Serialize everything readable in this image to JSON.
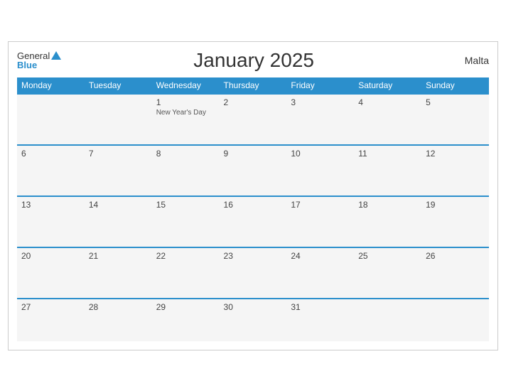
{
  "header": {
    "logo_general": "General",
    "logo_blue": "Blue",
    "title": "January 2025",
    "country": "Malta"
  },
  "weekdays": [
    "Monday",
    "Tuesday",
    "Wednesday",
    "Thursday",
    "Friday",
    "Saturday",
    "Sunday"
  ],
  "weeks": [
    [
      {
        "day": "",
        "empty": true
      },
      {
        "day": "",
        "empty": true
      },
      {
        "day": "1",
        "event": "New Year's Day"
      },
      {
        "day": "2"
      },
      {
        "day": "3"
      },
      {
        "day": "4"
      },
      {
        "day": "5"
      }
    ],
    [
      {
        "day": "6"
      },
      {
        "day": "7"
      },
      {
        "day": "8"
      },
      {
        "day": "9"
      },
      {
        "day": "10"
      },
      {
        "day": "11"
      },
      {
        "day": "12"
      }
    ],
    [
      {
        "day": "13"
      },
      {
        "day": "14"
      },
      {
        "day": "15"
      },
      {
        "day": "16"
      },
      {
        "day": "17"
      },
      {
        "day": "18"
      },
      {
        "day": "19"
      }
    ],
    [
      {
        "day": "20"
      },
      {
        "day": "21"
      },
      {
        "day": "22"
      },
      {
        "day": "23"
      },
      {
        "day": "24"
      },
      {
        "day": "25"
      },
      {
        "day": "26"
      }
    ],
    [
      {
        "day": "27"
      },
      {
        "day": "28"
      },
      {
        "day": "29"
      },
      {
        "day": "30"
      },
      {
        "day": "31"
      },
      {
        "day": "",
        "empty": true
      },
      {
        "day": "",
        "empty": true
      }
    ]
  ]
}
